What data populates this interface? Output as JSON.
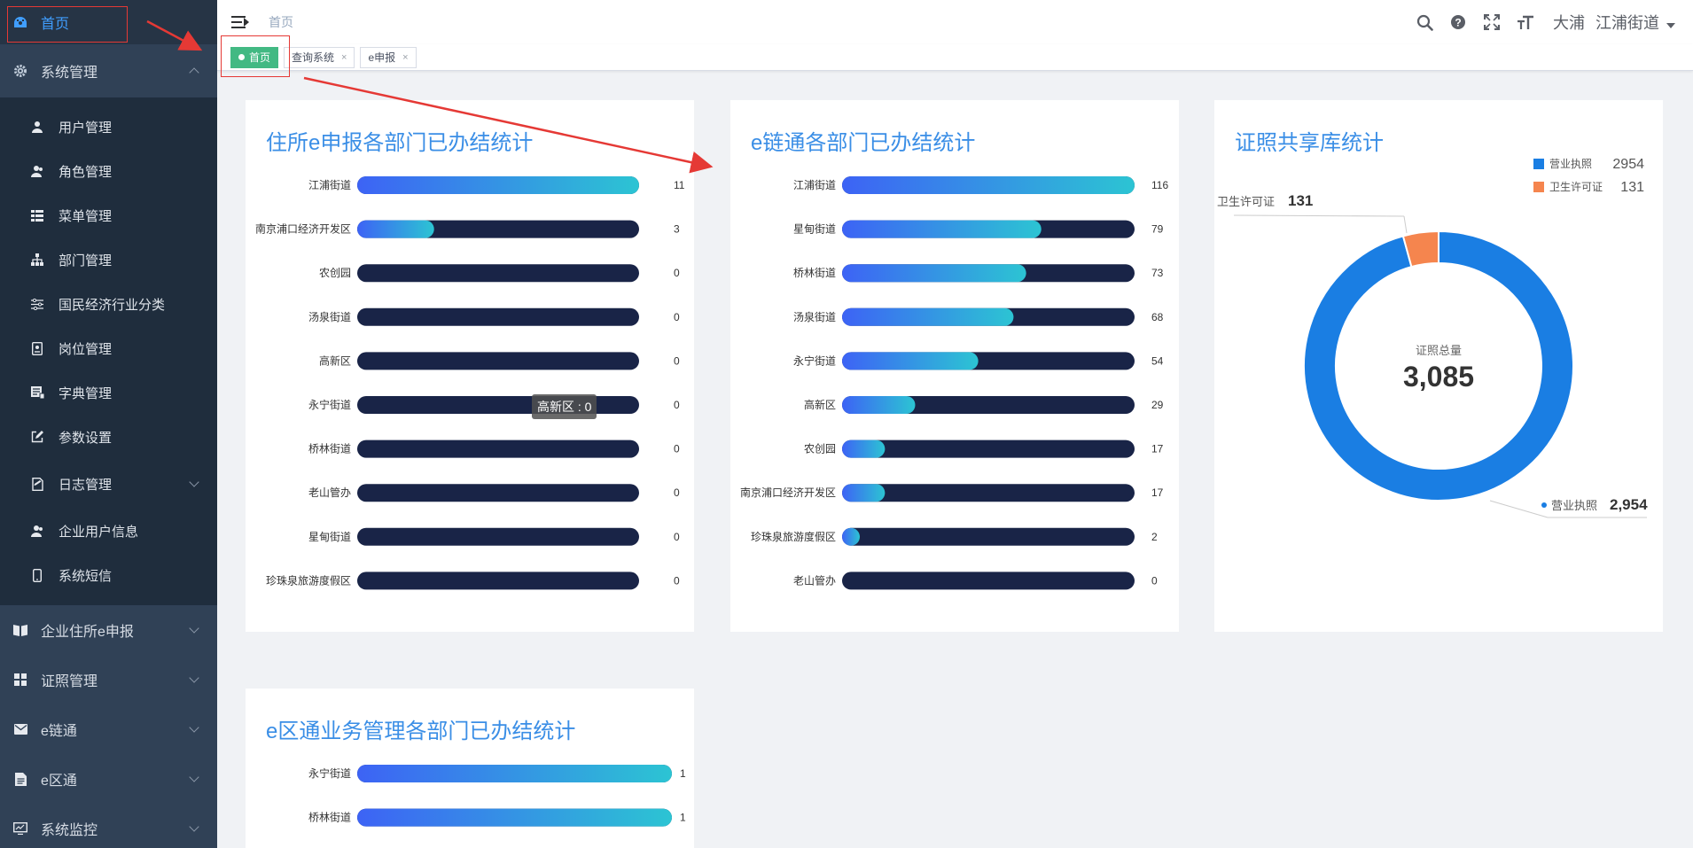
{
  "sidebar": {
    "home": {
      "label": "首页",
      "icon": "dashboard-icon"
    },
    "system": {
      "label": "系统管理",
      "icon": "gear-icon"
    },
    "system_items": [
      {
        "label": "用户管理",
        "icon": "user-icon"
      },
      {
        "label": "角色管理",
        "icon": "peoples-icon"
      },
      {
        "label": "菜单管理",
        "icon": "tree-table-icon"
      },
      {
        "label": "部门管理",
        "icon": "tree-icon"
      },
      {
        "label": "国民经济行业分类",
        "icon": "sliders-icon"
      },
      {
        "label": "岗位管理",
        "icon": "post-icon"
      },
      {
        "label": "字典管理",
        "icon": "dict-icon"
      },
      {
        "label": "参数设置",
        "icon": "edit-icon"
      },
      {
        "label": "日志管理",
        "icon": "log-icon"
      },
      {
        "label": "企业用户信息",
        "icon": "user-icon"
      },
      {
        "label": "系统短信",
        "icon": "phone-icon"
      }
    ],
    "groups": [
      {
        "label": "企业住所e申报",
        "icon": "book-icon"
      },
      {
        "label": "证照管理",
        "icon": "grid-icon"
      },
      {
        "label": "e链通",
        "icon": "mail-icon"
      },
      {
        "label": "e区通",
        "icon": "document-icon"
      },
      {
        "label": "系统监控",
        "icon": "monitor-icon"
      }
    ]
  },
  "navbar": {
    "breadcrumb": "首页",
    "user_name": "大浦",
    "user_street": "江浦街道"
  },
  "tags": [
    {
      "label": "首页",
      "active": true
    },
    {
      "label": "查询系统",
      "active": false
    },
    {
      "label": "e申报",
      "active": false
    }
  ],
  "tooltip": "高新区 : 0",
  "chart_data": [
    {
      "type": "bar",
      "title": "住所e申报各部门已办结统计",
      "categories": [
        "江浦街道",
        "南京浦口经济开发区",
        "农创园",
        "汤泉街道",
        "高新区",
        "永宁街道",
        "桥林街道",
        "老山管办",
        "星甸街道",
        "珍珠泉旅游度假区"
      ],
      "values": [
        11,
        3,
        0,
        0,
        0,
        0,
        0,
        0,
        0,
        0
      ],
      "xlim": [
        0,
        11
      ]
    },
    {
      "type": "bar",
      "title": "e链通各部门已办结统计",
      "categories": [
        "江浦街道",
        "星甸街道",
        "桥林街道",
        "汤泉街道",
        "永宁街道",
        "高新区",
        "农创园",
        "南京浦口经济开发区",
        "珍珠泉旅游度假区",
        "老山管办"
      ],
      "values": [
        116,
        79,
        73,
        68,
        54,
        29,
        17,
        17,
        2,
        0
      ],
      "xlim": [
        0,
        116
      ]
    },
    {
      "type": "pie",
      "title": "证照共享库统计",
      "center_label": "证照总量",
      "total": "3,085",
      "slices": [
        {
          "name": "营业执照",
          "value": 2954,
          "label_value": "2,954",
          "color": "#1a7ee3"
        },
        {
          "name": "卫生许可证",
          "value": 131,
          "label_value": "131",
          "color": "#f5854e"
        }
      ],
      "legend_values": [
        "2954",
        "131"
      ],
      "legend_position": "top-right"
    },
    {
      "type": "bar",
      "title": "e区通业务管理各部门已办结统计",
      "categories": [
        "永宁街道",
        "桥林街道"
      ],
      "values": [
        1,
        1
      ],
      "xlim": [
        0,
        1
      ]
    }
  ]
}
